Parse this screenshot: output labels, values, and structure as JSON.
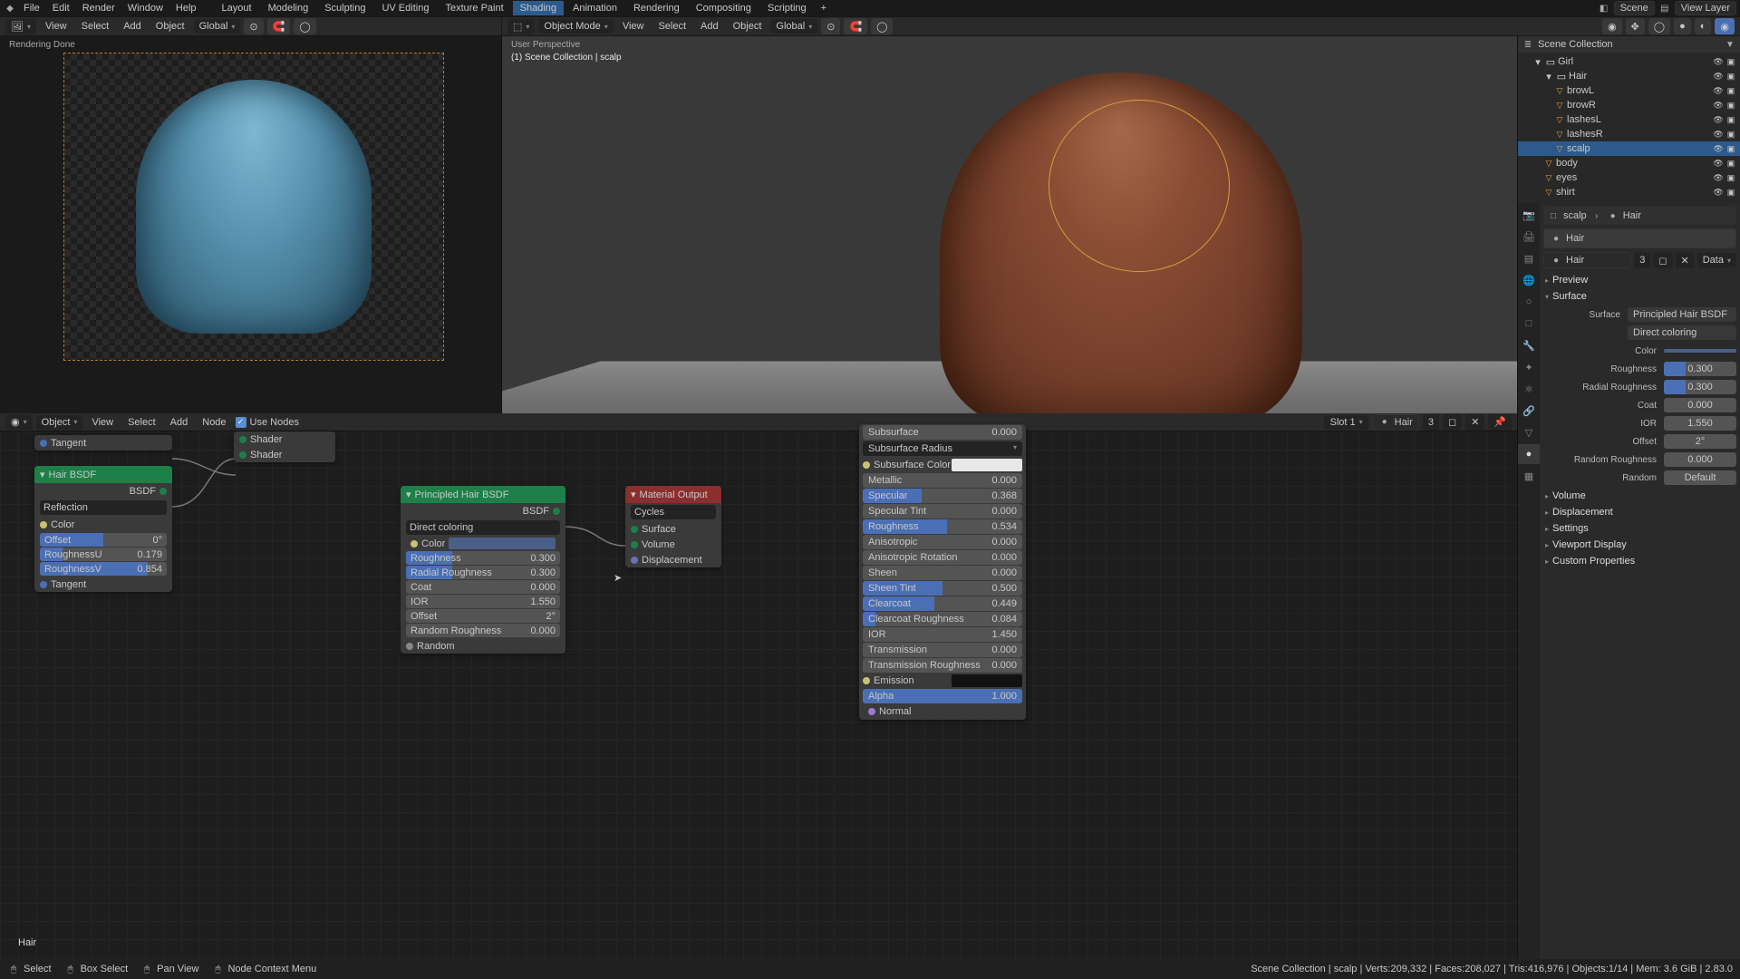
{
  "menubar": [
    "File",
    "Edit",
    "Render",
    "Window",
    "Help"
  ],
  "workspaces": [
    "Layout",
    "Modeling",
    "Sculpting",
    "UV Editing",
    "Texture Paint",
    "Shading",
    "Animation",
    "Rendering",
    "Compositing",
    "Scripting"
  ],
  "workspace_active": 5,
  "scene_label": "Scene",
  "viewlayer_label": "View Layer",
  "header_left": {
    "menus": [
      "View",
      "Select",
      "Add",
      "Object"
    ],
    "orientation": "Global"
  },
  "header_right": {
    "mode": "Object Mode",
    "menus": [
      "View",
      "Select",
      "Add",
      "Object"
    ],
    "orientation": "Global"
  },
  "render_pane": {
    "status": "Rendering Done"
  },
  "viewport": {
    "persp": "User Perspective",
    "path": "(1) Scene Collection | scalp"
  },
  "outliner": {
    "title": "Scene Collection",
    "items": [
      {
        "indent": 1,
        "icon": "col",
        "name": "Girl"
      },
      {
        "indent": 2,
        "icon": "col",
        "name": "Hair"
      },
      {
        "indent": 3,
        "icon": "mesh",
        "name": "browL"
      },
      {
        "indent": 3,
        "icon": "mesh",
        "name": "browR"
      },
      {
        "indent": 3,
        "icon": "mesh",
        "name": "lashesL"
      },
      {
        "indent": 3,
        "icon": "mesh",
        "name": "lashesR"
      },
      {
        "indent": 3,
        "icon": "mesh",
        "name": "scalp",
        "sel": true
      },
      {
        "indent": 2,
        "icon": "mesh",
        "name": "body"
      },
      {
        "indent": 2,
        "icon": "mesh",
        "name": "eyes"
      },
      {
        "indent": 2,
        "icon": "mesh",
        "name": "shirt"
      }
    ]
  },
  "props_header": {
    "obj": "scalp",
    "mat": "Hair"
  },
  "mat_slot": {
    "name": "Hair",
    "users": "3",
    "link": "Data"
  },
  "preview_label": "Preview",
  "surface_label": "Surface",
  "surface_field": {
    "lab": "Surface",
    "val": "Principled Hair BSDF"
  },
  "hair_mode": "Direct coloring",
  "props_sliders": [
    {
      "lab": "Color",
      "color": "#4a5f88"
    },
    {
      "lab": "Roughness",
      "val": "0.300",
      "bar": 30
    },
    {
      "lab": "Radial Roughness",
      "val": "0.300",
      "bar": 30
    },
    {
      "lab": "Coat",
      "val": "0.000",
      "bar": 0
    },
    {
      "lab": "IOR",
      "val": "1.550",
      "bar": 0
    },
    {
      "lab": "Offset",
      "val": "2°",
      "bar": 0
    },
    {
      "lab": "Random Roughness",
      "val": "0.000",
      "bar": 0
    },
    {
      "lab": "Random",
      "val": "Default",
      "bar": 0
    }
  ],
  "props_panels": [
    "Volume",
    "Displacement",
    "Settings",
    "Viewport Display",
    "Custom Properties"
  ],
  "node_editor": {
    "menus": [
      "View",
      "Select",
      "Add",
      "Node"
    ],
    "object": "Object",
    "use_nodes": "Use Nodes",
    "slot": "Slot 1",
    "mat": "Hair",
    "users": "3"
  },
  "node_hairbsdf": {
    "title": "Hair BSDF",
    "out": "BSDF",
    "mode": "Reflection",
    "sockets": [
      {
        "lab": "Color",
        "dot": "#c9c371"
      },
      {
        "lab": "Offset",
        "val": "0°",
        "bar": 50
      },
      {
        "lab": "RoughnessU",
        "val": "0.179",
        "bar": 18
      },
      {
        "lab": "RoughnessV",
        "val": "0.854",
        "bar": 85
      },
      {
        "lab": "Tangent",
        "dot": "#4a6fb5"
      }
    ],
    "tangent_top": "Tangent"
  },
  "mix_shader": {
    "s1": "Shader",
    "s2": "Shader"
  },
  "node_phair": {
    "title": "Principled Hair BSDF",
    "out": "BSDF",
    "mode": "Direct coloring",
    "color": "#4a5f88",
    "sliders": [
      {
        "lab": "Roughness",
        "val": "0.300",
        "bar": 30
      },
      {
        "lab": "Radial Roughness",
        "val": "0.300",
        "bar": 30
      },
      {
        "lab": "Coat",
        "val": "0.000",
        "bar": 0
      },
      {
        "lab": "IOR",
        "val": "1.550",
        "bar": 0
      },
      {
        "lab": "Offset",
        "val": "2°",
        "bar": 0
      },
      {
        "lab": "Random Roughness",
        "val": "0.000",
        "bar": 0
      }
    ],
    "random": "Random"
  },
  "node_output": {
    "title": "Material Output",
    "target": "Cycles",
    "ins": [
      {
        "lab": "Surface",
        "dot": "#1d8048"
      },
      {
        "lab": "Volume",
        "dot": "#1d8048"
      },
      {
        "lab": "Displacement",
        "dot": "#6b6fb5"
      }
    ]
  },
  "node_princ": {
    "top": [
      {
        "lab": "Subsurface",
        "val": "0.000",
        "bar": 0
      },
      {
        "lab": "Subsurface Radius",
        "sel": true
      }
    ],
    "color": {
      "lab": "Subsurface Color",
      "val": "#e8e8e8"
    },
    "sliders": [
      {
        "lab": "Metallic",
        "val": "0.000",
        "bar": 0
      },
      {
        "lab": "Specular",
        "val": "0.368",
        "bar": 37
      },
      {
        "lab": "Specular Tint",
        "val": "0.000",
        "bar": 0
      },
      {
        "lab": "Roughness",
        "val": "0.534",
        "bar": 53
      },
      {
        "lab": "Anisotropic",
        "val": "0.000",
        "bar": 0
      },
      {
        "lab": "Anisotropic Rotation",
        "val": "0.000",
        "bar": 0
      },
      {
        "lab": "Sheen",
        "val": "0.000",
        "bar": 0
      },
      {
        "lab": "Sheen Tint",
        "val": "0.500",
        "bar": 50
      },
      {
        "lab": "Clearcoat",
        "val": "0.449",
        "bar": 45
      },
      {
        "lab": "Clearcoat Roughness",
        "val": "0.084",
        "bar": 8
      },
      {
        "lab": "IOR",
        "val": "1.450",
        "bar": 0
      },
      {
        "lab": "Transmission",
        "val": "0.000",
        "bar": 0
      },
      {
        "lab": "Transmission Roughness",
        "val": "0.000",
        "bar": 0
      }
    ],
    "emission": {
      "lab": "Emission",
      "val": "#111111"
    },
    "alpha": {
      "lab": "Alpha",
      "val": "1.000",
      "bar": 100
    },
    "normal": "Normal"
  },
  "node_matname": "Hair",
  "status": {
    "select": "Select",
    "box": "Box Select",
    "pan": "Pan View",
    "ctx": "Node Context Menu",
    "right": "Scene Collection | scalp | Verts:209,332 | Faces:208,027 | Tris:416,976 | Objects:1/14 | Mem: 3.6 GiB | 2.83.0"
  }
}
